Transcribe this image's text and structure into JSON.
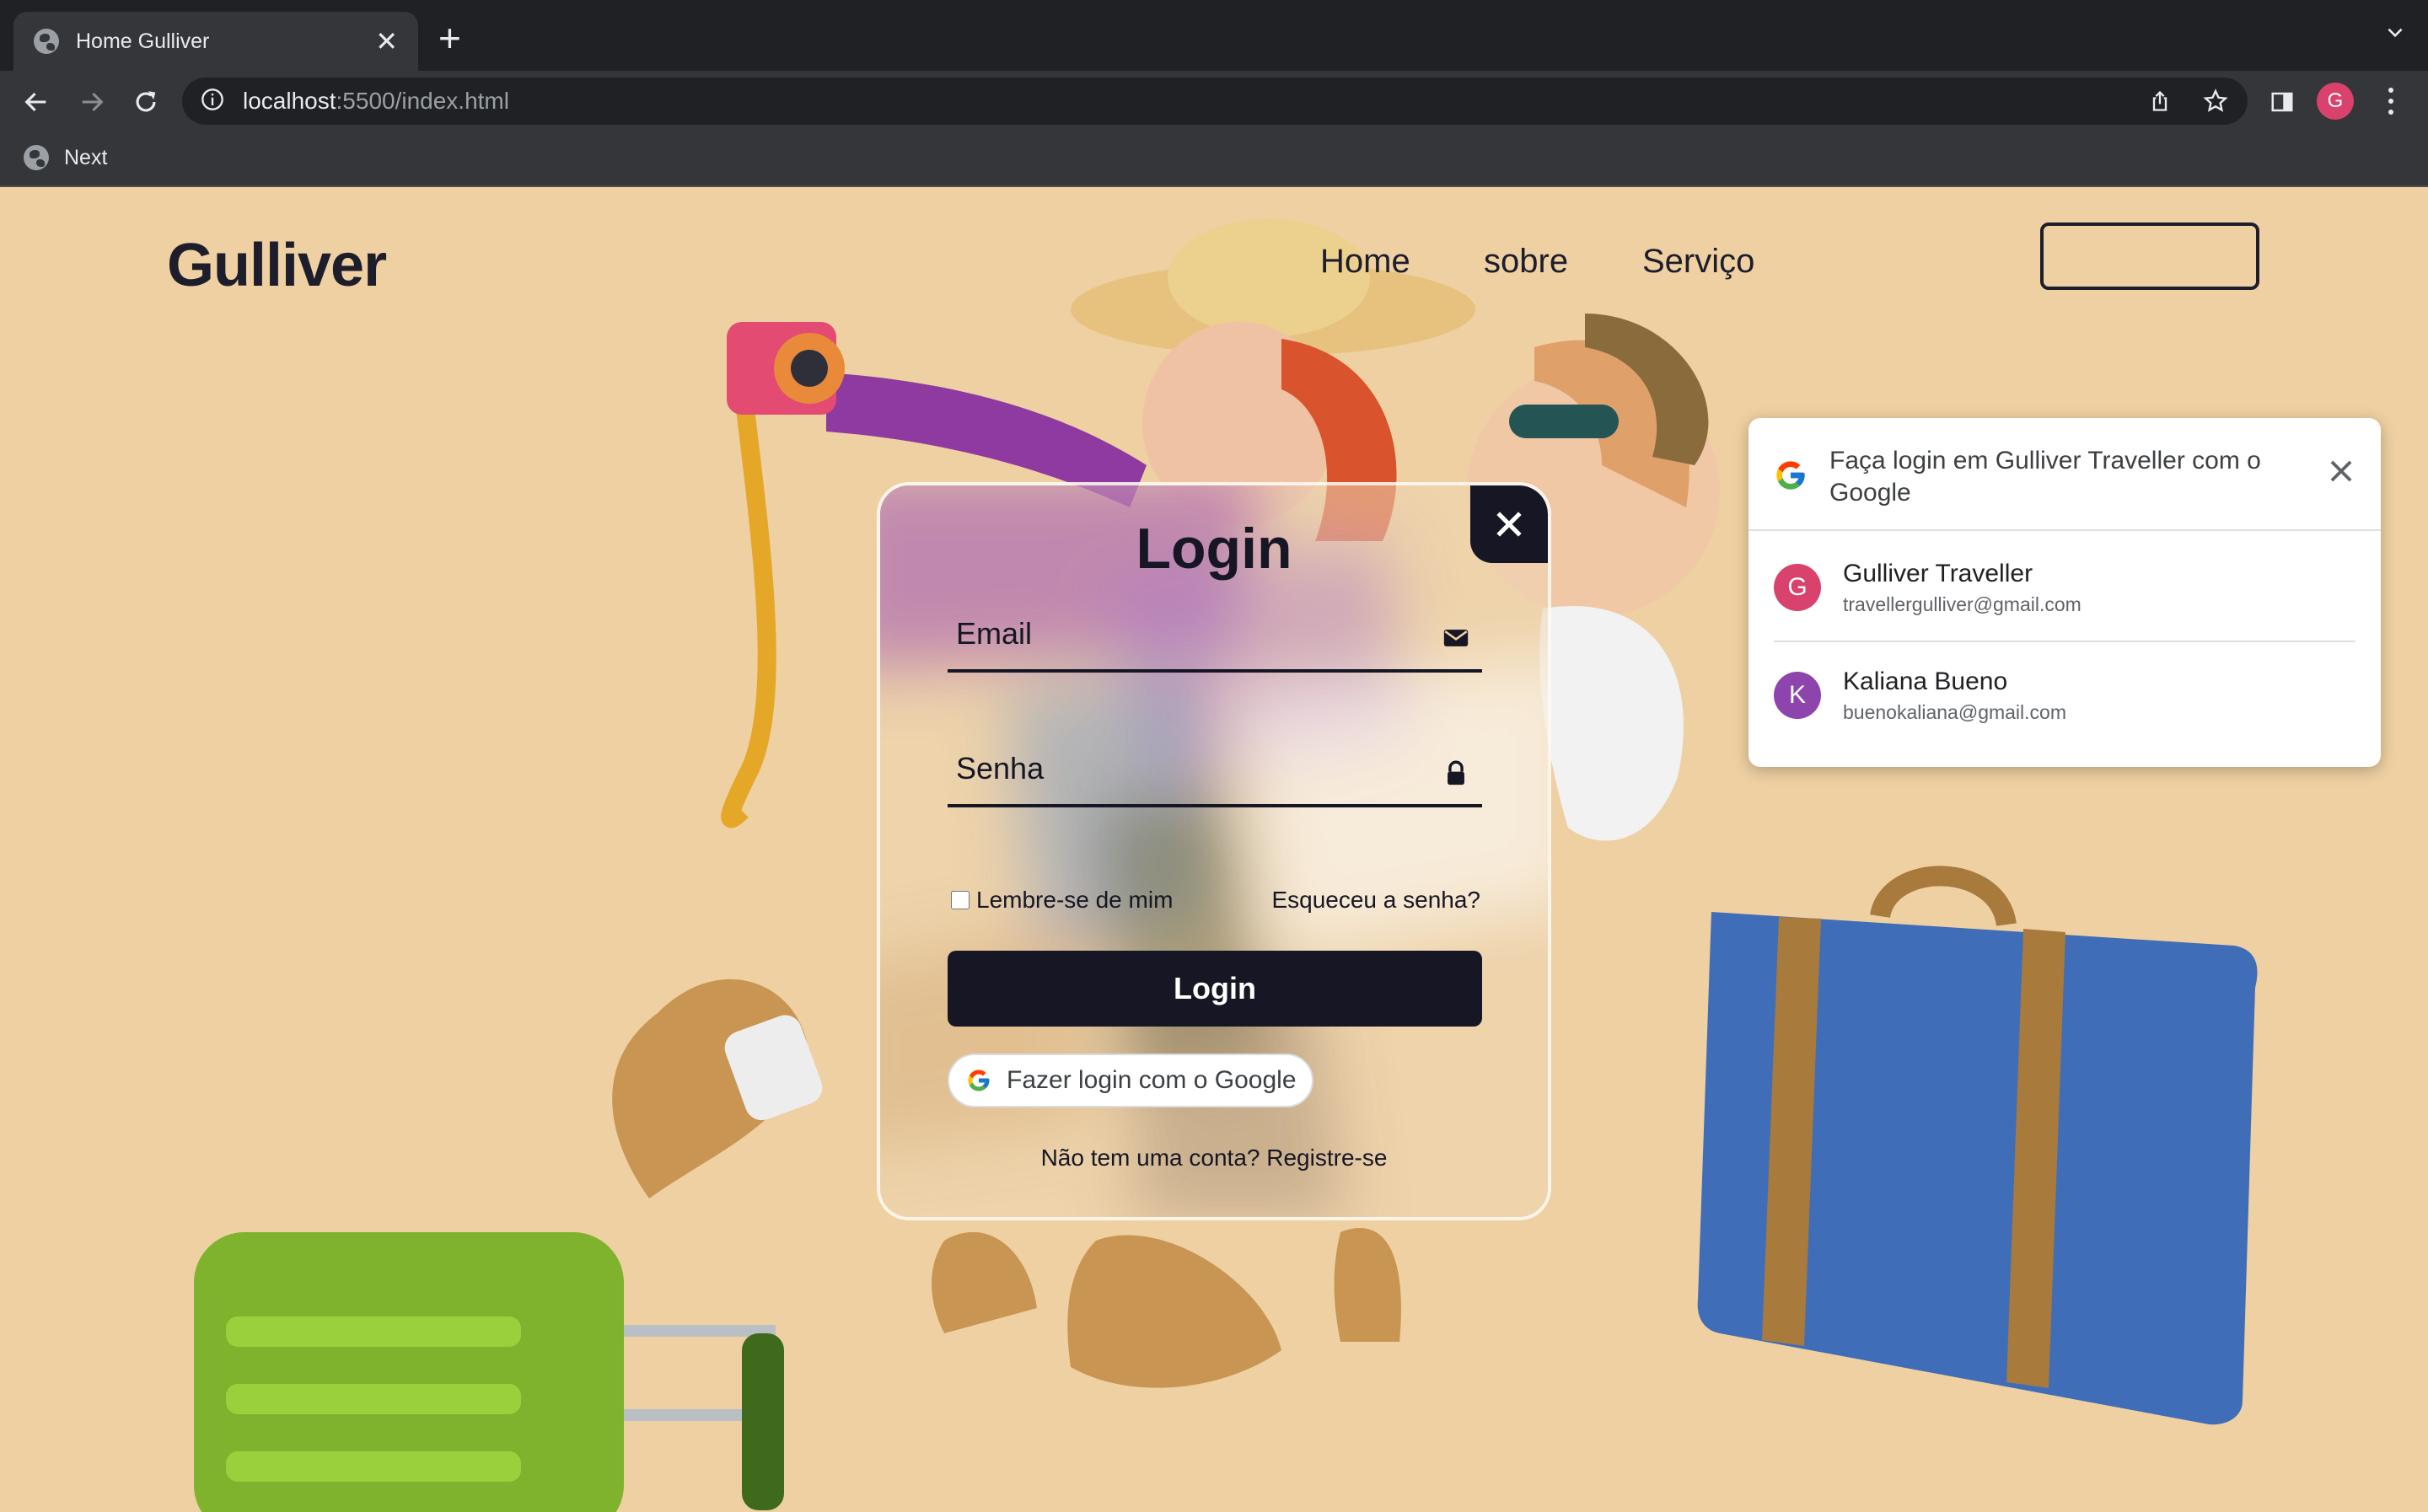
{
  "browser": {
    "tab": {
      "title": "Home Gulliver",
      "favicon": "globe-icon"
    },
    "address": {
      "host": "localhost",
      "path": ":5500/index.html"
    },
    "profile_initial": "G",
    "bookmarks": [
      {
        "label": "Next",
        "icon": "globe-icon"
      }
    ]
  },
  "site": {
    "brand": "Gulliver",
    "nav": [
      "Home",
      "sobre",
      "Serviço"
    ]
  },
  "login": {
    "title": "Login",
    "email_placeholder": "Email",
    "password_placeholder": "Senha",
    "remember_label": "Lembre-se de mim",
    "forgot_label": "Esqueceu a senha?",
    "submit_label": "Login",
    "google_button_label": "Fazer login com o Google",
    "signup_prompt": "Não tem uma conta?",
    "signup_link": "Registre-se"
  },
  "google_onetap": {
    "title": "Faça login em Gulliver Traveller com o Google",
    "accounts": [
      {
        "initial": "G",
        "name": "Gulliver Traveller",
        "email": "travellergulliver@gmail.com",
        "color": "#d9426c"
      },
      {
        "initial": "K",
        "name": "Kaliana Bueno",
        "email": "buenokaliana@gmail.com",
        "color": "#8e44ad"
      }
    ]
  },
  "colors": {
    "page_background": "#eed0a2",
    "dark": "#161624",
    "chrome_dark": "#202124",
    "chrome_toolbar": "#35363a"
  }
}
